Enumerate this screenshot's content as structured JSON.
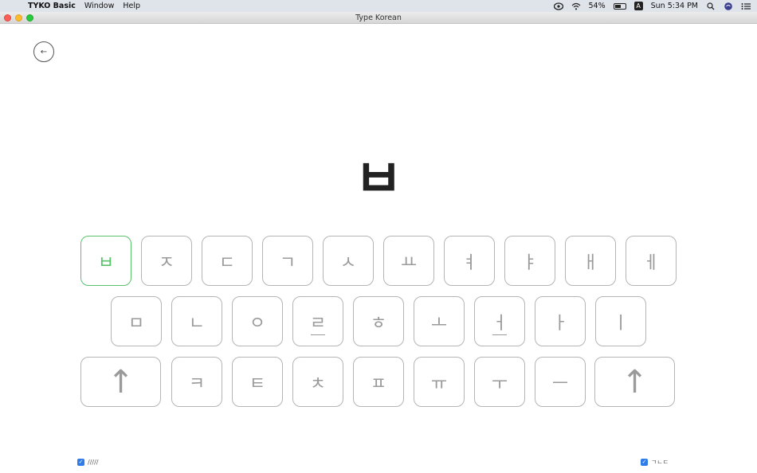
{
  "menubar": {
    "apple_icon": "apple-icon",
    "app_name": "TYKO Basic",
    "menus": [
      "Window",
      "Help"
    ],
    "battery_percent": "54%",
    "input_source": "A",
    "clock": "Sun 5:34 PM"
  },
  "window": {
    "title": "Type Korean"
  },
  "back_button": {
    "icon": "←"
  },
  "prompt": {
    "character": "ㅂ"
  },
  "keyboard": {
    "row1": [
      "ㅂ",
      "ㅈ",
      "ㄷ",
      "ㄱ",
      "ㅅ",
      "ㅛ",
      "ㅕ",
      "ㅑ",
      "ㅐ",
      "ㅔ"
    ],
    "row2": [
      "ㅁ",
      "ㄴ",
      "ㅇ",
      "ㄹ",
      "ㅎ",
      "ㅗ",
      "ㅓ",
      "ㅏ",
      "ㅣ"
    ],
    "row3": [
      "↑",
      "ㅋ",
      "ㅌ",
      "ㅊ",
      "ㅍ",
      "ㅠ",
      "ㅜ",
      "ㅡ",
      "↑"
    ],
    "active_key": "ㅂ",
    "colors": {
      "active": "#5ac26a",
      "inactive": "#9a9a9a",
      "border": "#b5b5b5"
    }
  },
  "options": {
    "left_label": "/////",
    "left_checked": true,
    "right_label": "ㄱㄴㄷ",
    "right_checked": true
  }
}
